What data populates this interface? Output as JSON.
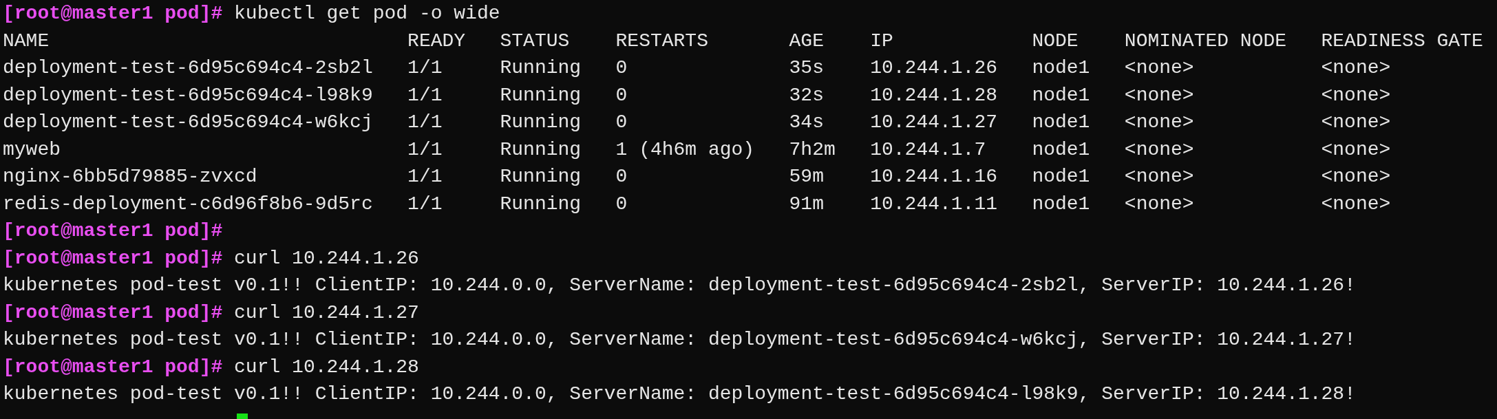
{
  "terminal": {
    "lines": [
      {
        "kind": "command",
        "prompt": "[root@master1 pod]#",
        "command": "kubectl get pod -o wide"
      },
      {
        "kind": "table",
        "columns": [
          "NAME",
          "READY",
          "STATUS",
          "RESTARTS",
          "AGE",
          "IP",
          "NODE",
          "NOMINATED NODE",
          "READINESS GATE"
        ],
        "rows": [
          [
            "deployment-test-6d95c694c4-2sb2l",
            "1/1",
            "Running",
            "0",
            "35s",
            "10.244.1.26",
            "node1",
            "<none>",
            "<none>"
          ],
          [
            "deployment-test-6d95c694c4-l98k9",
            "1/1",
            "Running",
            "0",
            "32s",
            "10.244.1.28",
            "node1",
            "<none>",
            "<none>"
          ],
          [
            "deployment-test-6d95c694c4-w6kcj",
            "1/1",
            "Running",
            "0",
            "34s",
            "10.244.1.27",
            "node1",
            "<none>",
            "<none>"
          ],
          [
            "myweb",
            "1/1",
            "Running",
            "1 (4h6m ago)",
            "7h2m",
            "10.244.1.7",
            "node1",
            "<none>",
            "<none>"
          ],
          [
            "nginx-6bb5d79885-zvxcd",
            "1/1",
            "Running",
            "0",
            "59m",
            "10.244.1.16",
            "node1",
            "<none>",
            "<none>"
          ],
          [
            "redis-deployment-c6d96f8b6-9d5rc",
            "1/1",
            "Running",
            "0",
            "91m",
            "10.244.1.11",
            "node1",
            "<none>",
            "<none>"
          ]
        ]
      },
      {
        "kind": "command",
        "prompt": "[root@master1 pod]#"
      },
      {
        "kind": "command",
        "prompt": "[root@master1 pod]#",
        "command": "curl 10.244.1.26"
      },
      {
        "kind": "output",
        "text": "kubernetes pod-test v0.1!! ClientIP: 10.244.0.0, ServerName: deployment-test-6d95c694c4-2sb2l, ServerIP: 10.244.1.26!"
      },
      {
        "kind": "command",
        "prompt": "[root@master1 pod]#",
        "command": "curl 10.244.1.27"
      },
      {
        "kind": "output",
        "text": "kubernetes pod-test v0.1!! ClientIP: 10.244.0.0, ServerName: deployment-test-6d95c694c4-w6kcj, ServerIP: 10.244.1.27!"
      },
      {
        "kind": "command",
        "prompt": "[root@master1 pod]#",
        "command": "curl 10.244.1.28"
      },
      {
        "kind": "output",
        "text": "kubernetes pod-test v0.1!! ClientIP: 10.244.0.0, ServerName: deployment-test-6d95c694c4-l98k9, ServerIP: 10.244.1.28!"
      },
      {
        "kind": "cursor"
      }
    ]
  }
}
